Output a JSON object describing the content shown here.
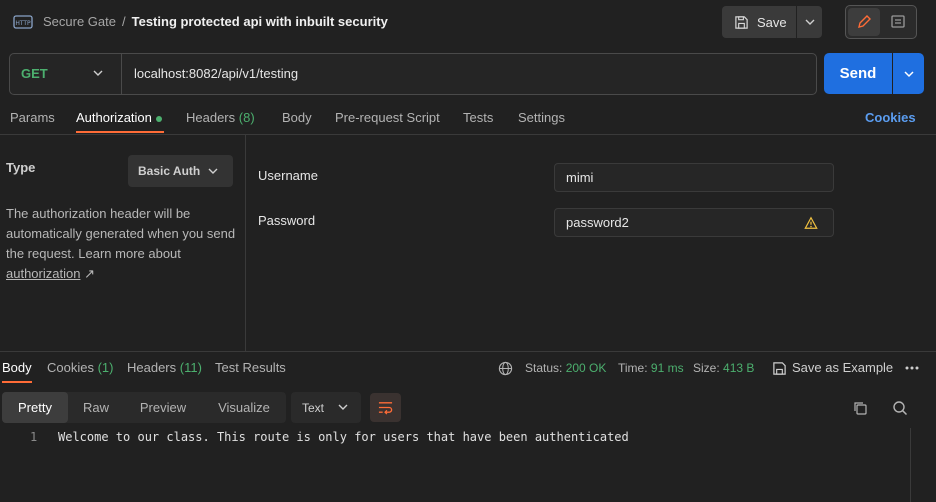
{
  "header": {
    "collection": "Secure Gate",
    "separator": "/",
    "request_name": "Testing protected api with inbuilt security",
    "save_label": "Save"
  },
  "request": {
    "method": "GET",
    "url": "localhost:8082/api/v1/testing",
    "send_label": "Send"
  },
  "tabs": {
    "params": "Params",
    "authorization": "Authorization",
    "headers": "Headers",
    "headers_count": "(8)",
    "body": "Body",
    "prerequest": "Pre-request Script",
    "tests": "Tests",
    "settings": "Settings",
    "cookies": "Cookies"
  },
  "auth": {
    "type_label": "Type",
    "type_value": "Basic Auth",
    "description": "The authorization header will be automatically generated when you send the request. Learn more about",
    "link_text": "authorization",
    "link_arrow": "↗",
    "username_label": "Username",
    "username_value": "mimi",
    "password_label": "Password",
    "password_value": "password2"
  },
  "response": {
    "tabs": {
      "body": "Body",
      "cookies": "Cookies",
      "cookies_count": "(1)",
      "headers": "Headers",
      "headers_count": "(11)",
      "test_results": "Test Results"
    },
    "status_label": "Status:",
    "status_value": "200 OK",
    "time_label": "Time:",
    "time_value": "91 ms",
    "size_label": "Size:",
    "size_value": "413 B",
    "save_example": "Save as Example",
    "formats": [
      "Pretty",
      "Raw",
      "Preview",
      "Visualize"
    ],
    "language": "Text",
    "line_number": "1",
    "line_text": "Welcome to our class. This route is only for users that have been authenticated"
  },
  "colors": {
    "accent_orange": "#ff6c37",
    "send_blue": "#1f6fe0",
    "success_green": "#4caf6e",
    "link_blue": "#5b9df0"
  }
}
